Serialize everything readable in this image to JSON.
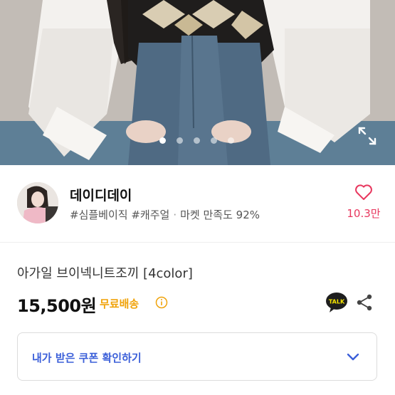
{
  "hero": {
    "image_alt": "product photo",
    "carousel_total": 5,
    "carousel_active": 1
  },
  "seller": {
    "name": "데이디데이",
    "tags": [
      "#심플베이직",
      "#캐주얼"
    ],
    "satisfaction": "마켓 만족도 92%",
    "likes": "10.3만"
  },
  "product": {
    "title": "아가일 브이넥니트조끼 [4color]",
    "price": "15,500원",
    "shipping": "무료배송"
  },
  "chat_icon_text": "TALK",
  "coupon": {
    "label": "내가 받은 쿠폰 확인하기"
  },
  "colors": {
    "accent_blue": "#3b5fd9",
    "like_red": "#e8375e",
    "shipping_orange": "#f0a30a"
  }
}
